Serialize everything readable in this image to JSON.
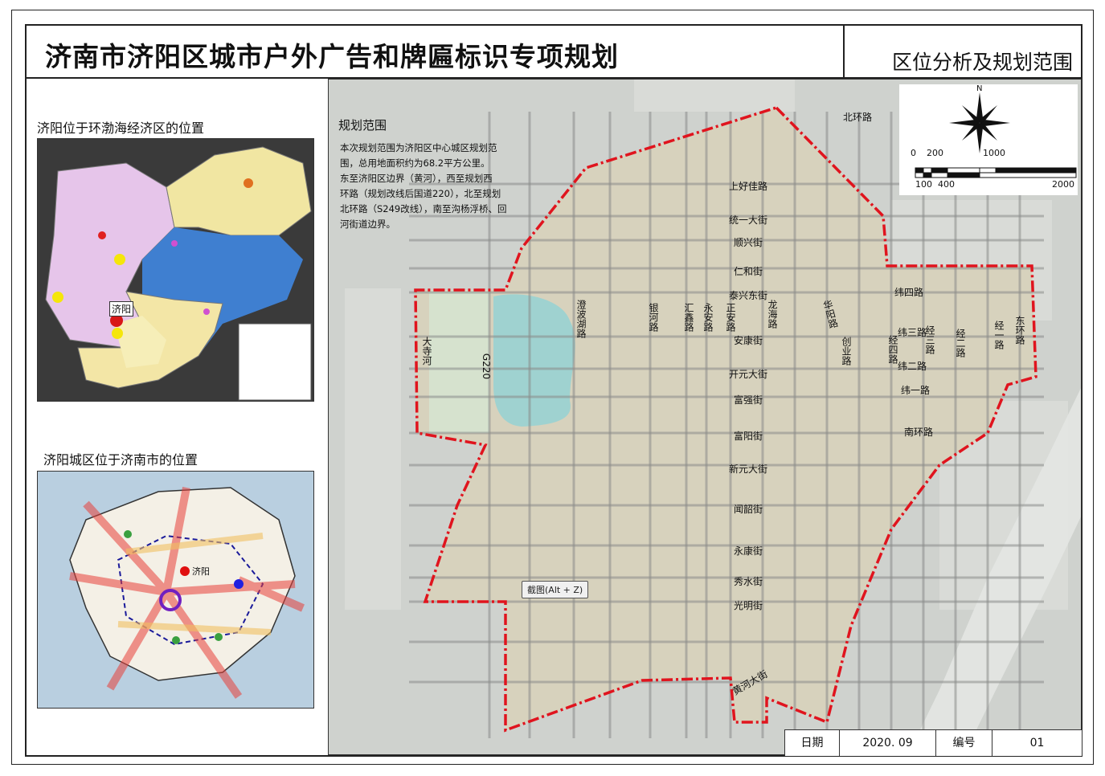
{
  "header": {
    "title": "济南市济阳区城市户外广告和牌匾标识专项规划",
    "subtitle": "区位分析及规划范围"
  },
  "left_panels": {
    "bohai": {
      "title": "济阳位于环渤海经济区的位置",
      "marker_label": "济阳"
    },
    "jinan": {
      "title": "济阳城区位于济南市的位置",
      "marker_label": "济阳"
    }
  },
  "main_map": {
    "description_title": "规划范围",
    "description_lines": [
      "本次规划范围为济阳区中心城区规划范",
      "围，总用地面积约为68.2平方公里。",
      "东至济阳区边界（黄河），西至规划西",
      "环路（规划改线后国道220），北至规划",
      "北环路（S249改线），南至沟杨浮桥、回",
      "河街道边界。"
    ],
    "north_label": "N",
    "scale_top": [
      "0",
      "200",
      "1000"
    ],
    "scale_bottom": [
      "100",
      "400",
      "2000"
    ],
    "tooltip": "截图(Alt + Z)",
    "road_labels": {
      "beihuan": "北环路",
      "shanghaojia": "上好佳路",
      "tongyi": "统一大街",
      "shunxin": "顺兴街",
      "renhe": "仁和街",
      "taixingdong": "泰兴东街",
      "ankang": "安康街",
      "kaiyuan": "开元大街",
      "fuqiang": "富强街",
      "fuyang": "富阳街",
      "xinyuan": "新元大街",
      "wenshao": "闻韶街",
      "yongkang": "永康街",
      "xiushui": "秀水街",
      "guangming": "光明街",
      "huanghe": "黄河大街",
      "weisi": "纬四路",
      "weisan": "纬三路",
      "weier": "纬二路",
      "weiyi": "纬一路",
      "nanhuan": "南环路",
      "dasihe": "大寺河",
      "g220": "G220",
      "chengbohu": "澄波湖路",
      "yinhe": "银河路",
      "huixin": "汇鑫路",
      "yongan": "永安路",
      "zhengan": "正安路",
      "longhai": "龙海路",
      "huayang": "华阳路",
      "chuangye": "创业路",
      "jingsi": "经四路",
      "jingsan": "经三路",
      "jinger": "经二路",
      "jingyi": "经一路",
      "donghuan": "东环路"
    }
  },
  "info_bar": {
    "date_label": "日期",
    "date_value": "2020. 09",
    "number_label": "编号",
    "number_value": "01"
  },
  "colors": {
    "boundary": "#e0141e",
    "sea": "#3f7fd0",
    "land_purple": "#e7c6e9",
    "land_yellow": "#f3e6a6",
    "land_green": "#d8ecb5"
  }
}
